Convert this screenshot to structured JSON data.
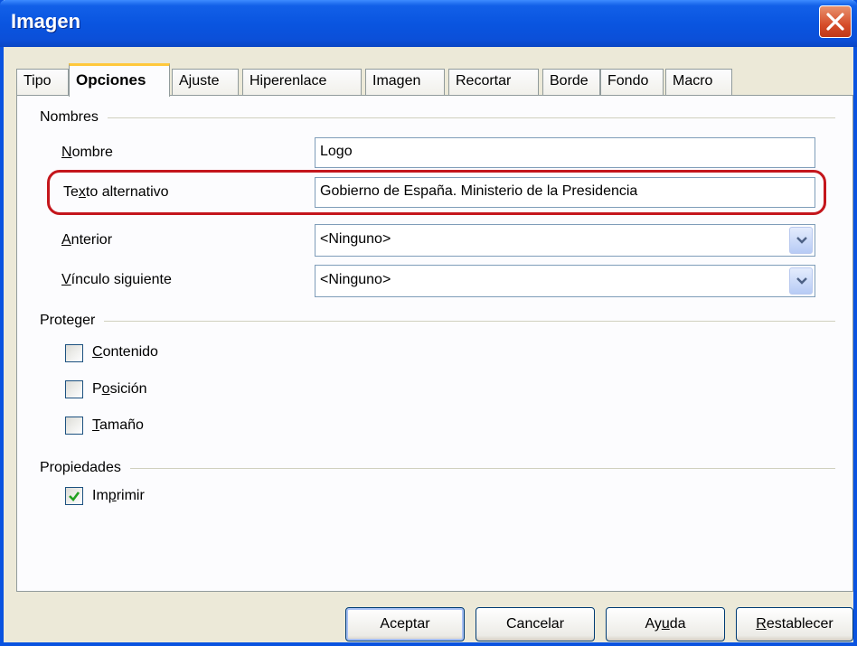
{
  "window": {
    "title": "Imagen"
  },
  "tabs": [
    {
      "label": "Tipo"
    },
    {
      "label": "Opciones",
      "active": true
    },
    {
      "label": "Ajuste"
    },
    {
      "label": "Hiperenlace"
    },
    {
      "label": "Imagen"
    },
    {
      "label": "Recortar"
    },
    {
      "label": "Borde"
    },
    {
      "label": "Fondo"
    },
    {
      "label": "Macro"
    }
  ],
  "nombres": {
    "section": "Nombres",
    "nombre_label": "Nombre",
    "nombre_value": "Logo",
    "alt_label": "Texto alternativo",
    "alt_value": "Gobierno de España. Ministerio de la Presidencia",
    "anterior_label": "Anterior",
    "anterior_value": "<Ninguno>",
    "siguiente_label": "Vínculo siguiente",
    "siguiente_value": "<Ninguno>"
  },
  "proteger": {
    "section": "Proteger",
    "contenido": {
      "label": "Contenido",
      "checked": false
    },
    "posicion": {
      "label": "Posición",
      "checked": false
    },
    "tamano": {
      "label": "Tamaño",
      "checked": false
    }
  },
  "propiedades": {
    "section": "Propiedades",
    "imprimir": {
      "label": "Imprimir",
      "checked": true
    }
  },
  "buttons": {
    "aceptar": "Aceptar",
    "cancelar": "Cancelar",
    "ayuda": "Ayuda",
    "restablecer": "Restablecer"
  },
  "colors": {
    "titlebar": "#0a55e0",
    "highlight": "#c4161c",
    "active_tab_accent": "#ffc83c"
  }
}
